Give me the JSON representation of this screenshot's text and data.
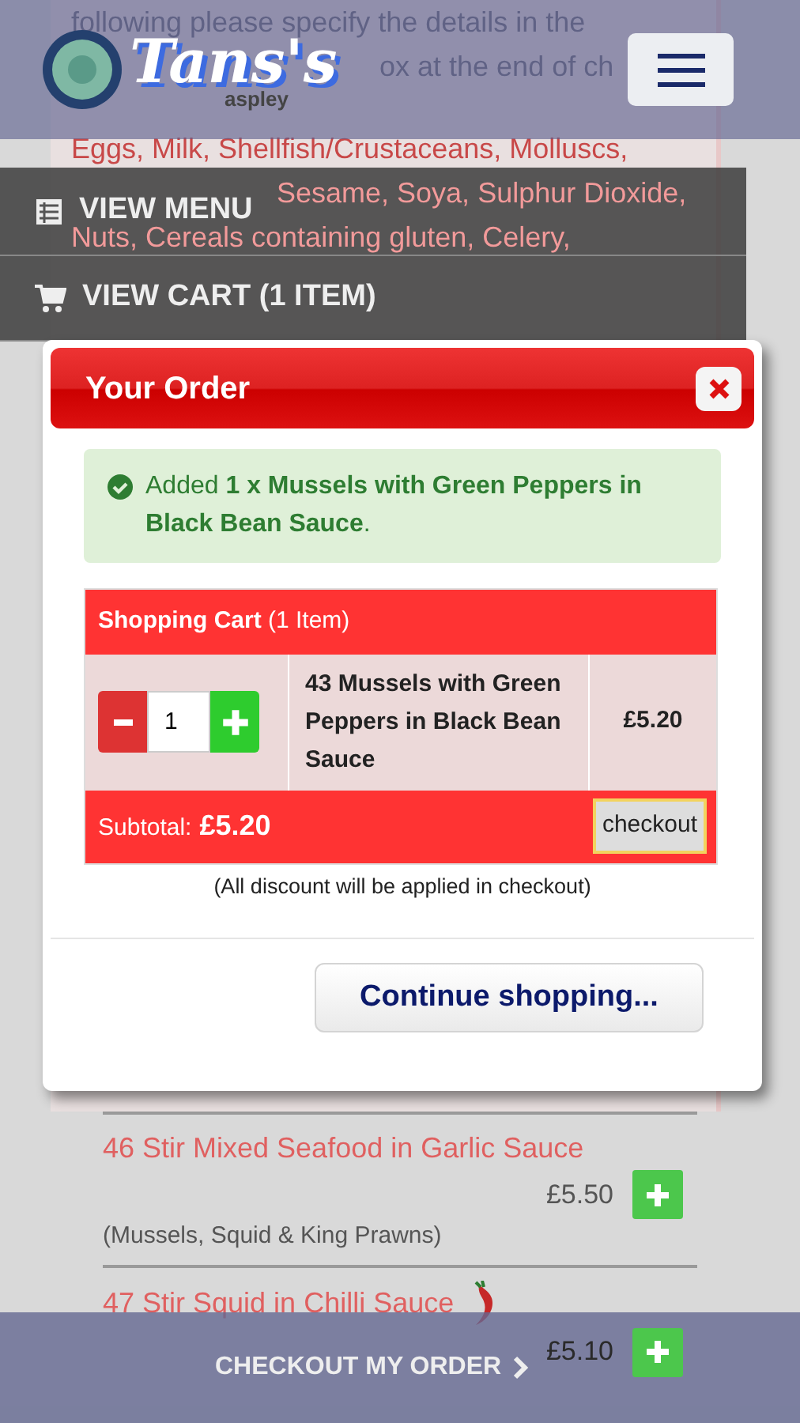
{
  "background": {
    "notice_lines": [
      "following please specify the details in the",
      "ox at the end of ch"
    ],
    "allergen_lines": [
      "Eggs, Milk, Shellfish/Crustaceans, Molluscs,",
      "Sesame, Soya, Sulphur Dioxide,",
      "Nuts, Cereals containing gluten, Celery,"
    ],
    "menu_items": [
      {
        "title": "46 Stir Mixed Seafood in Garlic Sauce",
        "price": "£5.50",
        "description": "(Mussels, Squid & King Prawns)",
        "spicy": false
      },
      {
        "title": "47 Stir Squid in Chilli Sauce",
        "price": "£5.10",
        "spicy": true
      }
    ]
  },
  "header": {
    "logo_text": "Tans's",
    "logo_subtext": "aspley"
  },
  "nav_menu": [
    {
      "label": "VIEW MENU"
    },
    {
      "label": "VIEW CART (1 ITEM)"
    }
  ],
  "modal": {
    "title": "Your Order",
    "alert": "Added **1 x Mussels with Green Peppers in Black Bean Sauce**.",
    "cart_title": "**Shopping Cart** (1 Item)",
    "items": [
      {
        "quantity": "1",
        "name": "43 Mussels with Green Peppers in Black Bean Sauce",
        "price": "£5.20"
      }
    ],
    "subtotal_label": "Subtotal:",
    "subtotal": "£5.20",
    "checkout_button": "checkout",
    "discount_note": "(All discount will be applied in checkout)",
    "continue_button": "Continue shopping..."
  },
  "checkout_bar": {
    "label": "CHECKOUT MY ORDER"
  }
}
